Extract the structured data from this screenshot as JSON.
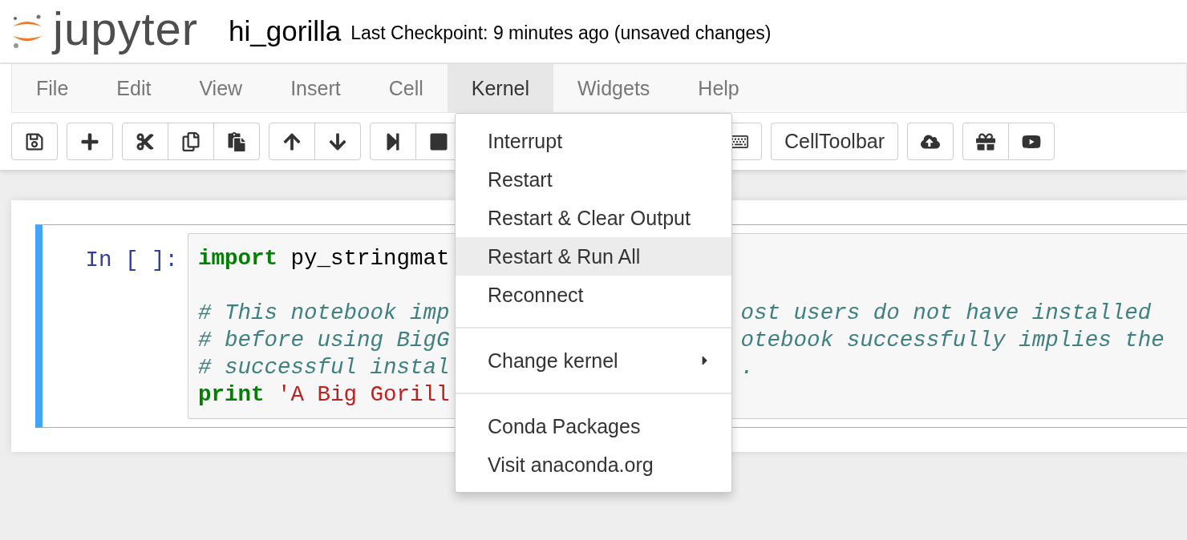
{
  "header": {
    "logo_text": "jupyter",
    "notebook_name": "hi_gorilla",
    "checkpoint": "Last Checkpoint: 9 minutes ago (unsaved changes)"
  },
  "menubar": [
    {
      "label": "File",
      "selected": false
    },
    {
      "label": "Edit",
      "selected": false
    },
    {
      "label": "View",
      "selected": false
    },
    {
      "label": "Insert",
      "selected": false
    },
    {
      "label": "Cell",
      "selected": false
    },
    {
      "label": "Kernel",
      "selected": true
    },
    {
      "label": "Widgets",
      "selected": false
    },
    {
      "label": "Help",
      "selected": false
    }
  ],
  "toolbar": {
    "cell_toolbar_button": "CellToolbar"
  },
  "cell": {
    "prompt": "In [ ]:",
    "lines": [
      {
        "kind": "code",
        "left": [
          {
            "kind": "keyword",
            "text": "import"
          },
          {
            "kind": "plain",
            "text": " py_stringmat"
          }
        ]
      },
      {
        "kind": "blank"
      },
      {
        "kind": "code",
        "left": [
          {
            "kind": "comment",
            "text": "# This notebook imp"
          }
        ],
        "right": [
          {
            "kind": "comment",
            "text": "ost users do not have installed"
          }
        ]
      },
      {
        "kind": "code",
        "left": [
          {
            "kind": "comment",
            "text": "# before using BigG"
          }
        ],
        "right": [
          {
            "kind": "comment",
            "text": "otebook successfully implies the"
          }
        ]
      },
      {
        "kind": "code",
        "left": [
          {
            "kind": "comment",
            "text": "# successful instal"
          }
        ],
        "right": [
          {
            "kind": "comment",
            "text": "."
          }
        ]
      },
      {
        "kind": "code",
        "left": [
          {
            "kind": "keyword",
            "text": "print"
          },
          {
            "kind": "string",
            "text": " 'A Big Gorill"
          }
        ]
      }
    ]
  },
  "kernel_menu": [
    {
      "kind": "item",
      "label": "Interrupt",
      "selected": false
    },
    {
      "kind": "item",
      "label": "Restart",
      "selected": false
    },
    {
      "kind": "item",
      "label": "Restart & Clear Output",
      "selected": false
    },
    {
      "kind": "item",
      "label": "Restart & Run All",
      "selected": true
    },
    {
      "kind": "item",
      "label": "Reconnect",
      "selected": false
    },
    {
      "kind": "divider"
    },
    {
      "kind": "submenu",
      "label": "Change kernel",
      "selected": false
    },
    {
      "kind": "divider"
    },
    {
      "kind": "item",
      "label": "Conda Packages",
      "selected": false
    },
    {
      "kind": "item",
      "label": "Visit anaconda.org",
      "selected": false
    }
  ]
}
